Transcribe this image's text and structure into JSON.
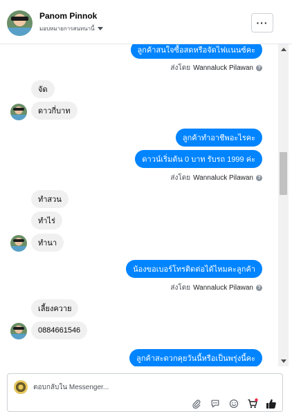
{
  "header": {
    "name": "Panom Pinnok",
    "subtitle": "มอบหมายการสนทนานี้",
    "more_label": "···"
  },
  "messages": [
    {
      "dir": "out",
      "text": "ลูกค้าสนใจซื้อสดหรือจัดไฟแนนซ์คะ"
    },
    {
      "type": "sent_by",
      "prefix": "ส่งโดย",
      "name": "Wannaluck Pilawan"
    },
    {
      "dir": "in",
      "text": "จัด"
    },
    {
      "dir": "in",
      "text": "ดาวกี่บาท"
    },
    {
      "dir": "out",
      "text": "ลูกค้าทำอาชีพอะไรคะ"
    },
    {
      "dir": "out",
      "text": "ดาวน์เริ่มต้น 0 บาท รับรถ 1999 ค่ะ"
    },
    {
      "type": "sent_by",
      "prefix": "ส่งโดย",
      "name": "Wannaluck Pilawan"
    },
    {
      "dir": "in",
      "text": "ทำสวน"
    },
    {
      "dir": "in",
      "text": "ทำไร่"
    },
    {
      "dir": "in",
      "text": "ทำนา"
    },
    {
      "dir": "out",
      "text": "น้องขอเบอร์โทรติดต่อได้ไหมคะลูกค้า"
    },
    {
      "type": "sent_by",
      "prefix": "ส่งโดย",
      "name": "Wannaluck Pilawan"
    },
    {
      "dir": "in",
      "text": "เลี้ยงควาย"
    },
    {
      "dir": "in",
      "text": "0884661546"
    },
    {
      "dir": "out",
      "text": "ลูกค้าสะดวกคุยวันนี้หรือเป็นพรุ่งนี้คะ"
    }
  ],
  "composer": {
    "placeholder": "ตอบกลับใน Messenger..."
  },
  "icons": {
    "attach": "paperclip-icon",
    "saved_replies": "speech-bubble-icon",
    "emoji": "smiley-icon",
    "cart": "cart-icon",
    "like": "thumbs-up-icon"
  },
  "colors": {
    "outgoing_bubble": "#0084ff",
    "incoming_bubble": "#f0f0f0",
    "cart_badge": "#f02849"
  }
}
